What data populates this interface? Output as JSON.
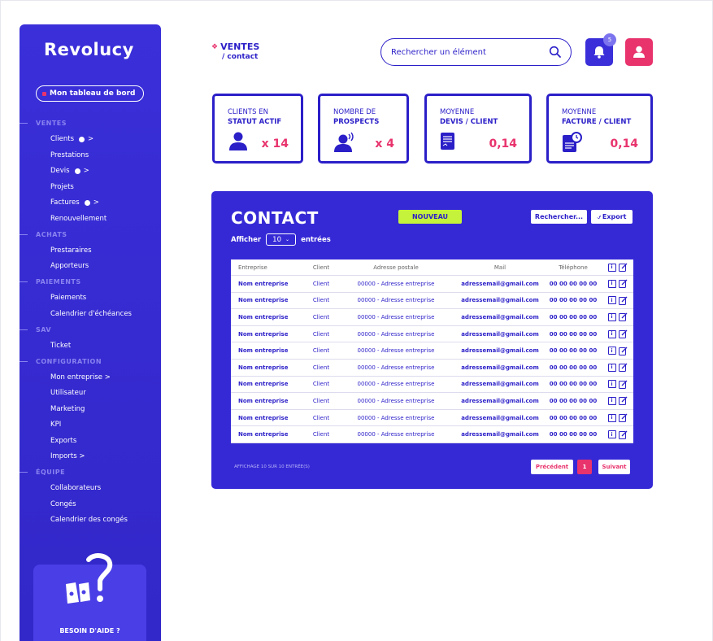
{
  "app": {
    "logo_text": "Revolucy"
  },
  "sidebar": {
    "dashboard_label": "Mon tableau de bord",
    "nav": [
      {
        "type": "section",
        "label": "VENTES"
      },
      {
        "type": "item",
        "label": "Clients",
        "gear": true,
        "arrow": ">"
      },
      {
        "type": "item",
        "label": "Prestations"
      },
      {
        "type": "item",
        "label": "Devis",
        "gear": true,
        "arrow": ">"
      },
      {
        "type": "item",
        "label": "Projets"
      },
      {
        "type": "item",
        "label": "Factures",
        "gear": true,
        "arrow": ">"
      },
      {
        "type": "item",
        "label": "Renouvellement"
      },
      {
        "type": "section",
        "label": "ACHATS"
      },
      {
        "type": "item",
        "label": "Prestaraires"
      },
      {
        "type": "item",
        "label": "Apporteurs"
      },
      {
        "type": "section",
        "label": "PAIEMENTS"
      },
      {
        "type": "item",
        "label": "Paiements"
      },
      {
        "type": "item",
        "label": "Calendrier d'échéances"
      },
      {
        "type": "section",
        "label": "SAV"
      },
      {
        "type": "item",
        "label": "Ticket"
      },
      {
        "type": "section",
        "label": "CONFIGURATION"
      },
      {
        "type": "item",
        "label": "Mon entreprise >"
      },
      {
        "type": "item",
        "label": "Utilisateur"
      },
      {
        "type": "item",
        "label": "Marketing"
      },
      {
        "type": "item",
        "label": "KPI"
      },
      {
        "type": "item",
        "label": "Exports"
      },
      {
        "type": "item",
        "label": "Imports >"
      },
      {
        "type": "section",
        "label": "ÉQUIPE"
      },
      {
        "type": "item",
        "label": "Collaborateurs"
      },
      {
        "type": "item",
        "label": "Congés"
      },
      {
        "type": "item",
        "label": "Calendrier des congés"
      }
    ],
    "help_label": "BESOIN D'AIDE ?"
  },
  "header": {
    "breadcrumb_main": "VENTES",
    "breadcrumb_sub": "/ contact",
    "search_placeholder": "Rechercher un élément",
    "notification_count": "5"
  },
  "stats": [
    {
      "line1": "CLIENTS EN",
      "line2": "STATUT ACTIF",
      "value": "x 14",
      "icon": "user-icon"
    },
    {
      "line1": "NOMBRE DE",
      "line2": "PROSPECTS",
      "value": "x 4",
      "icon": "prospect-icon"
    },
    {
      "line1": "MOYENNE",
      "line2": "DEVIS / CLIENT",
      "value": "0,14",
      "icon": "quote-document-icon"
    },
    {
      "line1": "MOYENNE",
      "line2": "FACTURE / CLIENT",
      "value": "0,14",
      "icon": "invoice-document-icon"
    }
  ],
  "contact": {
    "title": "CONTACT",
    "new_label": "NOUVEAU",
    "search_label": "Rechercher...",
    "export_label": "Export",
    "show_label": "Afficher",
    "entries_label": "entrées",
    "page_size": "10",
    "columns": [
      "Entreprise",
      "Client",
      "Adresse postale",
      "Mail",
      "Téléphone"
    ],
    "rows": [
      [
        "Nom entreprise",
        "Client",
        "00000 - Adresse entreprise",
        "adressemail@gmail.com",
        "00 00 00 00 00"
      ],
      [
        "Nom entreprise",
        "Client",
        "00000 - Adresse entreprise",
        "adressemail@gmail.com",
        "00 00 00 00 00"
      ],
      [
        "Nom entreprise",
        "Client",
        "00000 - Adresse entreprise",
        "adressemail@gmail.com",
        "00 00 00 00 00"
      ],
      [
        "Nom entreprise",
        "Client",
        "00000 - Adresse entreprise",
        "adressemail@gmail.com",
        "00 00 00 00 00"
      ],
      [
        "Nom entreprise",
        "Client",
        "00000 - Adresse entreprise",
        "adressemail@gmail.com",
        "00 00 00 00 00"
      ],
      [
        "Nom entreprise",
        "Client",
        "00000 - Adresse entreprise",
        "adressemail@gmail.com",
        "00 00 00 00 00"
      ],
      [
        "Nom entreprise",
        "Client",
        "00000 - Adresse entreprise",
        "adressemail@gmail.com",
        "00 00 00 00 00"
      ],
      [
        "Nom entreprise",
        "Client",
        "00000 - Adresse entreprise",
        "adressemail@gmail.com",
        "00 00 00 00 00"
      ],
      [
        "Nom entreprise",
        "Client",
        "00000 - Adresse entreprise",
        "adressemail@gmail.com",
        "00 00 00 00 00"
      ],
      [
        "Nom entreprise",
        "Client",
        "00000 - Adresse entreprise",
        "adressemail@gmail.com",
        "00 00 00 00 00"
      ]
    ],
    "info_text": "AFFICHAGE 10 SUR 10 ENTRÉE(S)",
    "prev_label": "Précédent",
    "current_page": "1",
    "next_label": "Suivant"
  },
  "colors": {
    "primary": "#3529d6",
    "accent": "#e8336d",
    "lime": "#c5f23a"
  }
}
